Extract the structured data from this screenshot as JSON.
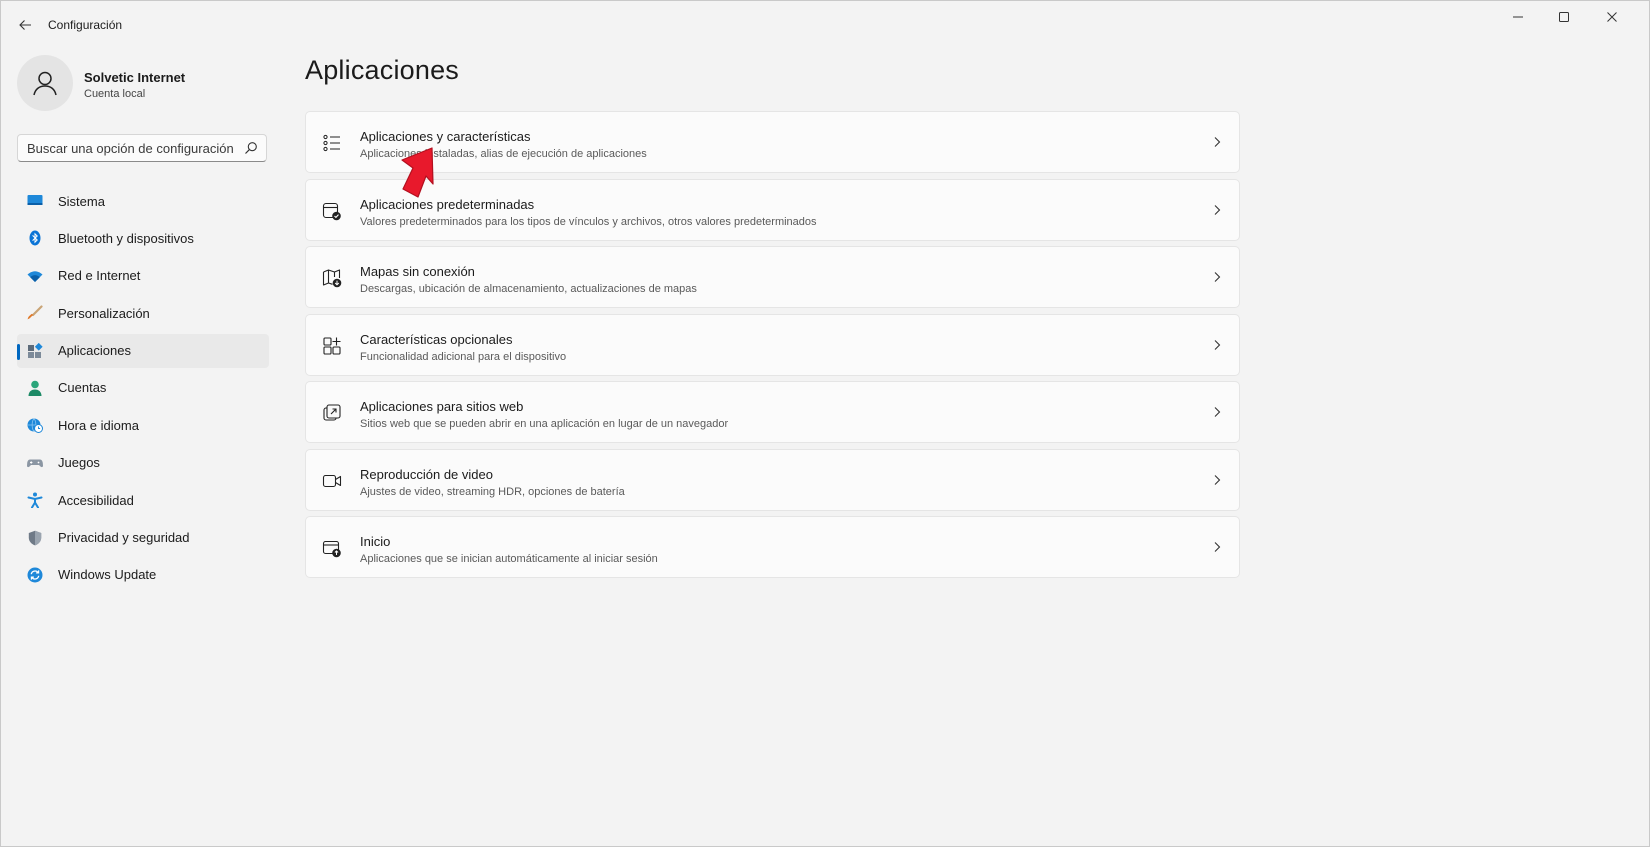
{
  "window": {
    "title": "Configuración"
  },
  "profile": {
    "name": "Solvetic Internet",
    "account_type": "Cuenta local"
  },
  "search": {
    "placeholder": "Buscar una opción de configuración",
    "value": ""
  },
  "sidebar": {
    "items": [
      {
        "label": "Sistema",
        "icon": "monitor-icon",
        "active": false
      },
      {
        "label": "Bluetooth y dispositivos",
        "icon": "bluetooth-icon",
        "active": false
      },
      {
        "label": "Red e Internet",
        "icon": "wifi-icon",
        "active": false
      },
      {
        "label": "Personalización",
        "icon": "paintbrush-icon",
        "active": false
      },
      {
        "label": "Aplicaciones",
        "icon": "apps-icon",
        "active": true
      },
      {
        "label": "Cuentas",
        "icon": "person-icon",
        "active": false
      },
      {
        "label": "Hora e idioma",
        "icon": "globe-clock-icon",
        "active": false
      },
      {
        "label": "Juegos",
        "icon": "gamepad-icon",
        "active": false
      },
      {
        "label": "Accesibilidad",
        "icon": "accessibility-icon",
        "active": false
      },
      {
        "label": "Privacidad y seguridad",
        "icon": "shield-icon",
        "active": false
      },
      {
        "label": "Windows Update",
        "icon": "update-icon",
        "active": false
      }
    ]
  },
  "main": {
    "title": "Aplicaciones",
    "cards": [
      {
        "title": "Aplicaciones y características",
        "description": "Aplicaciones instaladas, alias de ejecución de aplicaciones",
        "icon": "list-icon"
      },
      {
        "title": "Aplicaciones predeterminadas",
        "description": "Valores predeterminados para los tipos de vínculos y archivos, otros valores predeterminados",
        "icon": "default-app-icon"
      },
      {
        "title": "Mapas sin conexión",
        "description": "Descargas, ubicación de almacenamiento, actualizaciones de mapas",
        "icon": "map-download-icon"
      },
      {
        "title": "Características opcionales",
        "description": "Funcionalidad adicional para el dispositivo",
        "icon": "add-grid-icon"
      },
      {
        "title": "Aplicaciones para sitios web",
        "description": "Sitios web que se pueden abrir en una aplicación en lugar de un navegador",
        "icon": "open-in-app-icon"
      },
      {
        "title": "Reproducción de video",
        "description": "Ajustes de video, streaming HDR, opciones de batería",
        "icon": "video-camera-icon"
      },
      {
        "title": "Inicio",
        "description": "Aplicaciones que se inician automáticamente al iniciar sesión",
        "icon": "startup-icon"
      }
    ]
  },
  "colors": {
    "accent": "#0067c0",
    "annotation": "#e8192c",
    "window_bg": "#f3f3f3",
    "card_bg": "#fbfbfb"
  }
}
